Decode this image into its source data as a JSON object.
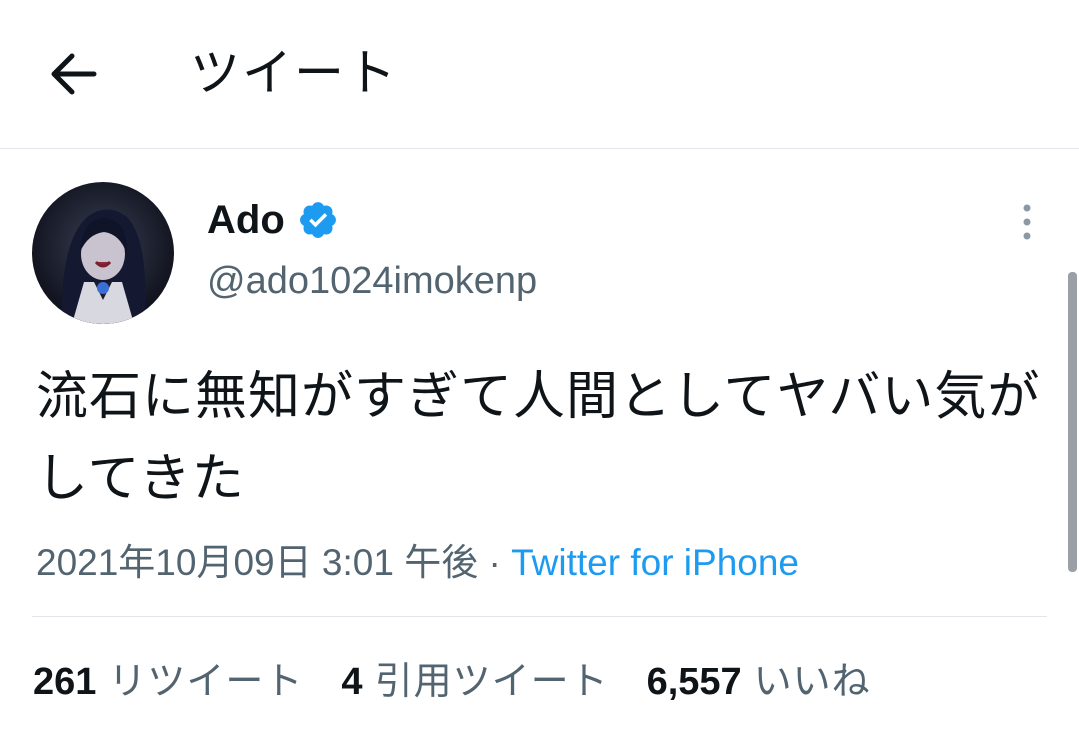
{
  "header": {
    "title": "ツイート"
  },
  "author": {
    "display_name": "Ado",
    "handle": "@ado1024imokenp",
    "verified": true
  },
  "tweet": {
    "text": "流石に無知がすぎて人間としてヤバい気がしてきた",
    "timestamp": "2021年10月09日 3:01 午後",
    "separator": " · ",
    "source": "Twitter for iPhone"
  },
  "stats": [
    {
      "count": "261",
      "label": "リツイート"
    },
    {
      "count": "4",
      "label": "引用ツイート"
    },
    {
      "count": "6,557",
      "label": "いいね"
    }
  ],
  "colors": {
    "accent": "#1d9bf0",
    "text": "#0f1419",
    "secondary": "#536471",
    "divider": "#e3e6ea"
  },
  "icons": {
    "back": "arrow-left-icon",
    "verified": "verified-badge-icon",
    "more": "more-vertical-icon"
  }
}
